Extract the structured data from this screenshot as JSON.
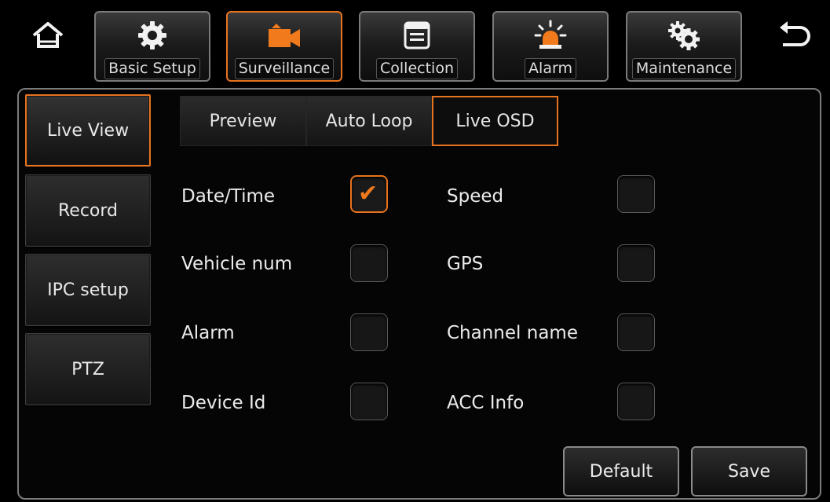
{
  "top_nav": {
    "home_icon": "home-icon",
    "back_icon": "back-arrow-icon",
    "items": [
      {
        "label": "Basic Setup",
        "icon": "gear-icon"
      },
      {
        "label": "Surveillance",
        "icon": "camera-icon"
      },
      {
        "label": "Collection",
        "icon": "document-icon"
      },
      {
        "label": "Alarm",
        "icon": "alarm-light-icon"
      },
      {
        "label": "Maintenance",
        "icon": "gears-icon"
      }
    ],
    "active": "Surveillance"
  },
  "sidebar": {
    "items": [
      {
        "label": "Live View"
      },
      {
        "label": "Record"
      },
      {
        "label": "IPC setup"
      },
      {
        "label": "PTZ"
      }
    ],
    "active": "Live View"
  },
  "tabs": {
    "items": [
      {
        "label": "Preview"
      },
      {
        "label": "Auto Loop"
      },
      {
        "label": "Live OSD"
      }
    ],
    "active": "Live OSD"
  },
  "options": {
    "left": [
      {
        "label": "Date/Time",
        "checked": true
      },
      {
        "label": "Vehicle num",
        "checked": false
      },
      {
        "label": "Alarm",
        "checked": false
      },
      {
        "label": "Device Id",
        "checked": false
      }
    ],
    "right": [
      {
        "label": "Speed",
        "checked": false
      },
      {
        "label": "GPS",
        "checked": false
      },
      {
        "label": "Channel name",
        "checked": false
      },
      {
        "label": "ACC Info",
        "checked": false
      }
    ],
    "check_glyph": "✔"
  },
  "actions": {
    "default_label": "Default",
    "save_label": "Save"
  },
  "colors": {
    "accent": "#e8731e"
  }
}
